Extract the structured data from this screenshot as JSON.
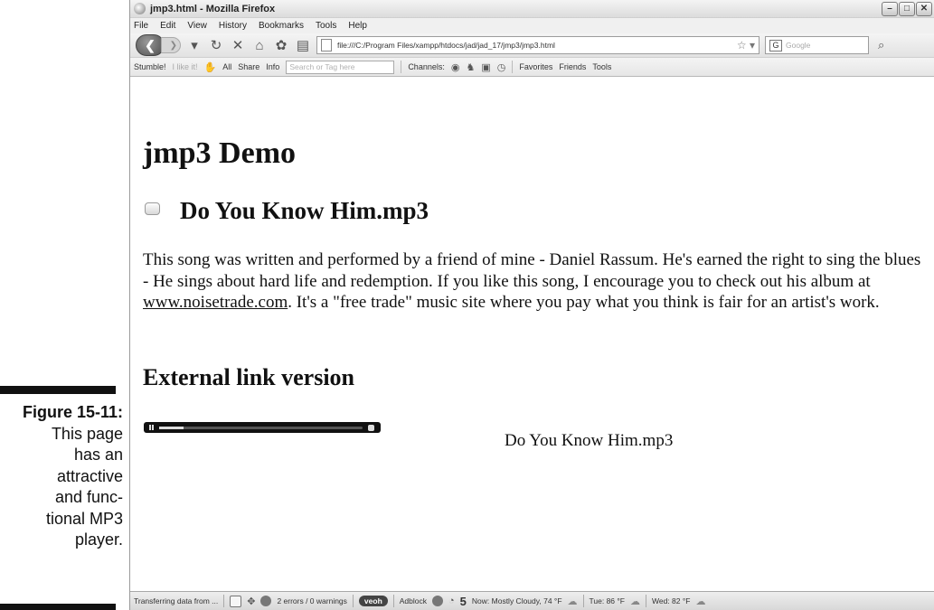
{
  "figure": {
    "number": "Figure 15-11:",
    "caption_lines": [
      "This page",
      "has an",
      "attractive",
      "and func-",
      "tional MP3",
      "player."
    ]
  },
  "browser": {
    "window_title": "jmp3.html - Mozilla Firefox",
    "menu": [
      "File",
      "Edit",
      "View",
      "History",
      "Bookmarks",
      "Tools",
      "Help"
    ],
    "url": "file:///C:/Program Files/xampp/htdocs/jad/jad_17/jmp3/jmp3.html",
    "search_placeholder": "Google",
    "toolbar2": {
      "stumble": "Stumble!",
      "like": "I like it!",
      "all": "All",
      "share": "Share",
      "info": "Info",
      "tag_placeholder": "Search or Tag here",
      "channels": "Channels:",
      "favorites": "Favorites",
      "friends": "Friends",
      "tools": "Tools"
    },
    "status": {
      "transfer": "Transferring data from ...",
      "errors": "2 errors / 0 warnings",
      "veoh": "veoh",
      "adblock": "Adblock",
      "count": "5",
      "now": "Now: Mostly Cloudy, 74 °F",
      "tue": "Tue: 86 °F",
      "wed": "Wed: 82 °F"
    }
  },
  "page": {
    "heading": "jmp3 Demo",
    "song_title": "Do You Know Him.mp3",
    "paragraph_before_link": "This song was written and performed by a friend of mine - Daniel Rassum. He's earned the right to sing the blues - He sings about hard life and redemption. If you like this song, I encourage you to check out his album at ",
    "link_text": "www.noisetrade.com",
    "paragraph_after_link": ". It's a \"free trade\" music site where you pay what you think is fair for an artist's work.",
    "external_heading": "External link version",
    "external_song_title": "Do You Know Him.mp3",
    "player_progress": 0.12
  }
}
